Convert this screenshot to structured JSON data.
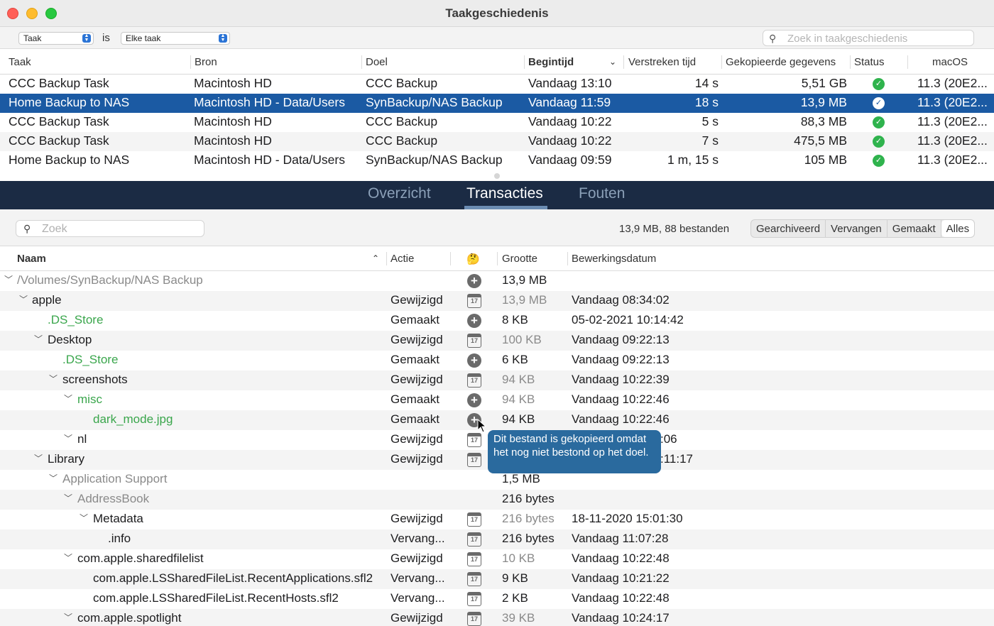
{
  "window": {
    "title": "Taakgeschiedenis"
  },
  "filter": {
    "field": "Taak",
    "is_label": "is",
    "value": "Elke taak",
    "search_placeholder": "Zoek in taakgeschiedenis"
  },
  "history": {
    "columns": [
      "Taak",
      "Bron",
      "Doel",
      "Begintijd",
      "Verstreken tijd",
      "Gekopieerde gegevens",
      "Status",
      "macOS"
    ],
    "rows": [
      [
        "CCC Backup Task",
        "Macintosh HD",
        "CCC Backup",
        "Vandaag 13:10",
        "14 s",
        "5,51 GB",
        "ok",
        "11.3 (20E2..."
      ],
      [
        "Home Backup to NAS",
        "Macintosh HD - Data/Users",
        "SynBackup/NAS Backup",
        "Vandaag 11:59",
        "18 s",
        "13,9 MB",
        "ok",
        "11.3 (20E2..."
      ],
      [
        "CCC Backup Task",
        "Macintosh HD",
        "CCC Backup",
        "Vandaag 10:22",
        "5 s",
        "88,3 MB",
        "ok",
        "11.3 (20E2..."
      ],
      [
        "CCC Backup Task",
        "Macintosh HD",
        "CCC Backup",
        "Vandaag 10:22",
        "7 s",
        "475,5 MB",
        "ok",
        "11.3 (20E2..."
      ],
      [
        "Home Backup to NAS",
        "Macintosh HD - Data/Users",
        "SynBackup/NAS Backup",
        "Vandaag 09:59",
        "1 m, 15 s",
        "105 MB",
        "ok",
        "11.3 (20E2..."
      ]
    ],
    "selected_row": 1
  },
  "tabs": [
    "Overzicht",
    "Transacties",
    "Fouten"
  ],
  "active_tab": "Transacties",
  "transactions": {
    "search_placeholder": "Zoek",
    "summary": "13,9 MB, 88 bestanden",
    "filters": [
      "Gearchiveerd",
      "Vervangen",
      "Gemaakt",
      "Alles"
    ],
    "active_filter": "Alles",
    "columns": {
      "name": "Naam",
      "action": "Actie",
      "icon": "🤔",
      "size": "Grootte",
      "date": "Bewerkingsdatum"
    },
    "rows": [
      {
        "name": "/Volumes/SynBackup/NAS Backup",
        "action": "",
        "icon": "plus",
        "size": "13,9 MB",
        "date": ""
      },
      {
        "name": "apple",
        "action": "Gewijzigd",
        "icon": "calendar",
        "size": "13,9 MB",
        "date": "Vandaag 08:34:02"
      },
      {
        "name": ".DS_Store",
        "action": "Gemaakt",
        "icon": "plus",
        "size": "8 KB",
        "date": "05-02-2021 10:14:42"
      },
      {
        "name": "Desktop",
        "action": "Gewijzigd",
        "icon": "calendar",
        "size": "100 KB",
        "date": "Vandaag 09:22:13"
      },
      {
        "name": ".DS_Store",
        "action": "Gemaakt",
        "icon": "plus",
        "size": "6 KB",
        "date": "Vandaag 09:22:13"
      },
      {
        "name": "screenshots",
        "action": "Gewijzigd",
        "icon": "calendar",
        "size": "94 KB",
        "date": "Vandaag 10:22:39"
      },
      {
        "name": "misc",
        "action": "Gemaakt",
        "icon": "plus",
        "size": "94 KB",
        "date": "Vandaag 10:22:46"
      },
      {
        "name": "dark_mode.jpg",
        "action": "Gemaakt",
        "icon": "plus",
        "size": "94 KB",
        "date": "Vandaag 10:22:46"
      },
      {
        "name": "nl",
        "action": "Gewijzigd",
        "icon": "calendar",
        "size": "",
        "date": ":06"
      },
      {
        "name": "Library",
        "action": "Gewijzigd",
        "icon": "calendar",
        "size": "",
        "date": ":11:17"
      },
      {
        "name": "Application Support",
        "action": "",
        "icon": "",
        "size": "1,5 MB",
        "date": ""
      },
      {
        "name": "AddressBook",
        "action": "",
        "icon": "",
        "size": "216 bytes",
        "date": ""
      },
      {
        "name": "Metadata",
        "action": "Gewijzigd",
        "icon": "calendar",
        "size": "216 bytes",
        "date": "18-11-2020 15:01:30"
      },
      {
        "name": ".info",
        "action": "Vervang...",
        "icon": "calendar",
        "size": "216 bytes",
        "date": "Vandaag 11:07:28"
      },
      {
        "name": "com.apple.sharedfilelist",
        "action": "Gewijzigd",
        "icon": "calendar",
        "size": "10 KB",
        "date": "Vandaag 10:22:48"
      },
      {
        "name": "com.apple.LSSharedFileList.RecentApplications.sfl2",
        "action": "Vervang...",
        "icon": "calendar",
        "size": "9 KB",
        "date": "Vandaag 10:21:22"
      },
      {
        "name": "com.apple.LSSharedFileList.RecentHosts.sfl2",
        "action": "Vervang...",
        "icon": "calendar",
        "size": "2 KB",
        "date": "Vandaag 10:22:48"
      },
      {
        "name": "com.apple.spotlight",
        "action": "Gewijzigd",
        "icon": "calendar",
        "size": "39 KB",
        "date": "Vandaag 10:24:17"
      }
    ]
  },
  "tooltip": {
    "text": "Dit bestand is gekopieerd omdat het nog niet bestond op het doel."
  },
  "colors": {
    "selection": "#1b5aa3",
    "tab_band": "#1b2b44",
    "status_ok": "#2fb34d",
    "created_green": "#3aa64c",
    "tooltip_bg": "#2a6a9e"
  }
}
